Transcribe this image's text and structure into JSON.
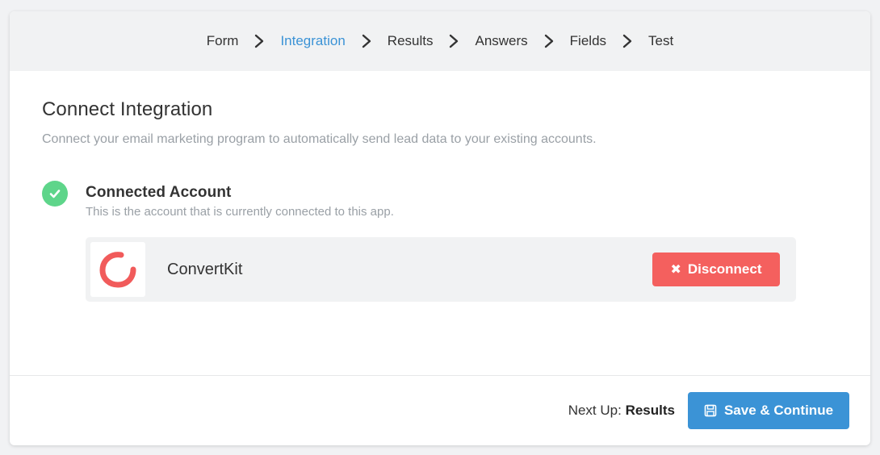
{
  "stepper": {
    "steps": [
      {
        "label": "Form",
        "active": false
      },
      {
        "label": "Integration",
        "active": true
      },
      {
        "label": "Results",
        "active": false
      },
      {
        "label": "Answers",
        "active": false
      },
      {
        "label": "Fields",
        "active": false
      },
      {
        "label": "Test",
        "active": false
      }
    ]
  },
  "main": {
    "title": "Connect Integration",
    "subtitle": "Connect your email marketing program to automatically send lead data to your existing accounts."
  },
  "connected": {
    "title": "Connected Account",
    "subtitle": "This is the account that is currently connected to this app.",
    "status_icon": "check-circle-icon"
  },
  "account": {
    "name": "ConvertKit",
    "logo_icon": "convertkit-logo-icon",
    "disconnect_label": "Disconnect",
    "disconnect_icon": "close-icon"
  },
  "footer": {
    "next_up_label": "Next Up:",
    "next_up_value": "Results",
    "save_label": "Save & Continue",
    "save_icon": "floppy-disk-icon"
  },
  "colors": {
    "accent": "#3b93d6",
    "danger": "#f4605e",
    "success": "#5ed58a",
    "brand_convertkit": "#f15b5b"
  }
}
